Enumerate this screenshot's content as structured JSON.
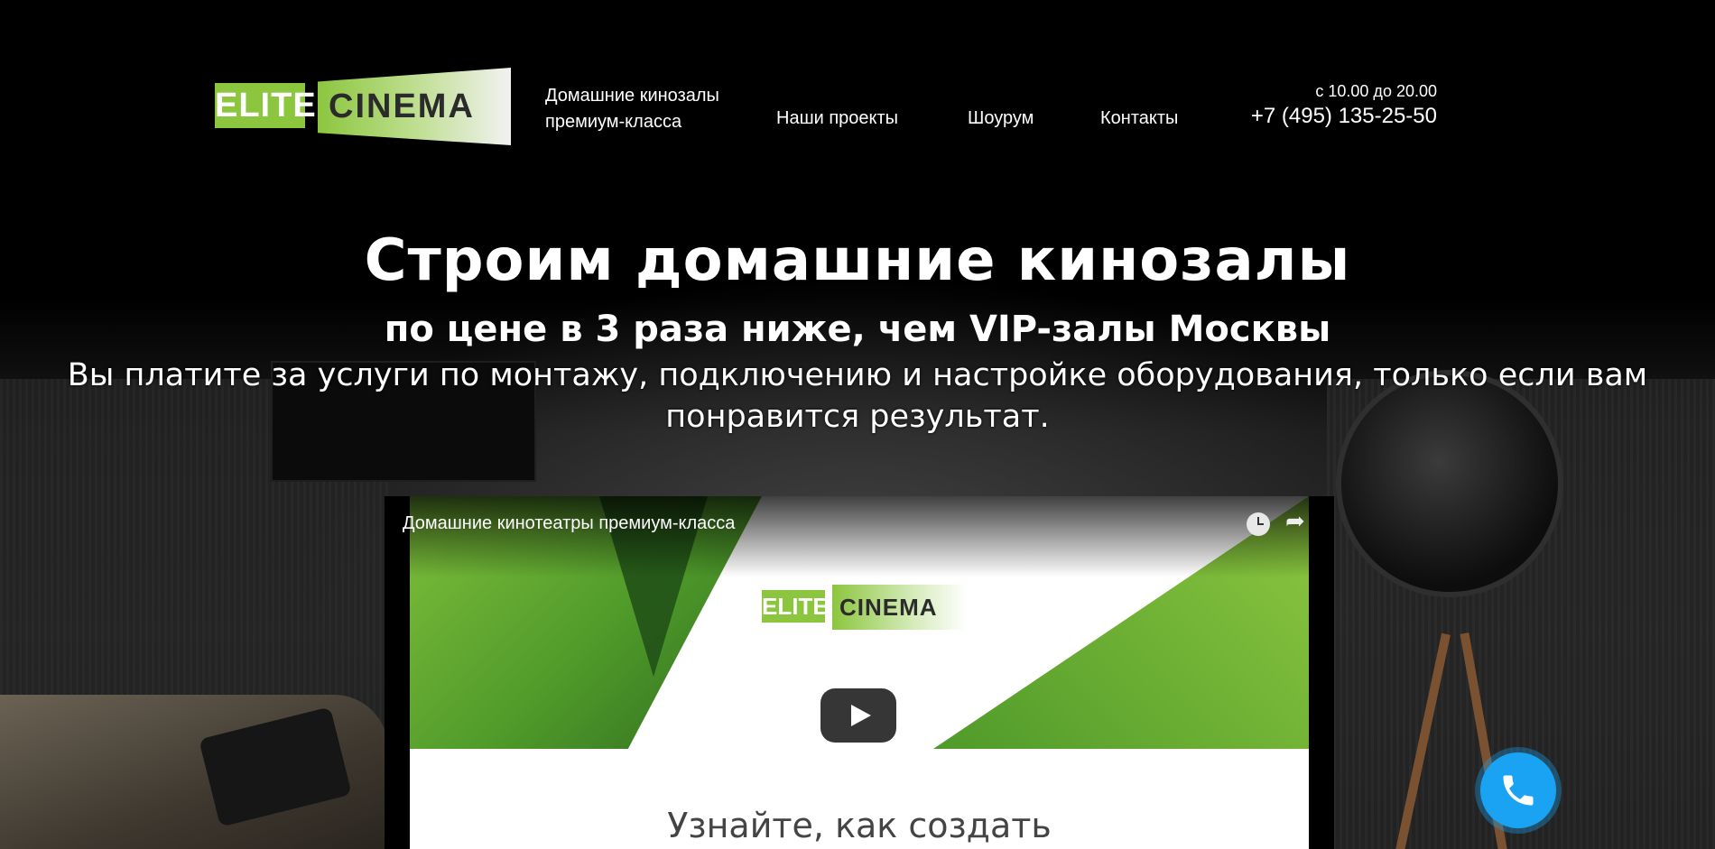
{
  "header": {
    "logo_left": "ELITE",
    "logo_right": "CINEMA",
    "tagline_line1": "Домашние кинозалы",
    "tagline_line2": "премиум-класса",
    "nav": [
      "Наши проекты",
      "Шоурум",
      "Контакты"
    ],
    "hours": "с 10.00 до 20.00",
    "phone": "+7 (495) 135-25-50"
  },
  "hero": {
    "title": "Строим домашние кинозалы",
    "subtitle": "по цене в 3 раза ниже, чем VIP-залы Москвы",
    "description": "Вы платите за услуги по монтажу, подключению и настройке оборудования, только если вам понравится результат."
  },
  "video": {
    "title": "Домашние кинотеатры премиум-класса",
    "logo_left": "ELITE",
    "logo_right": "CINEMA",
    "caption": "Узнайте, как создать",
    "icons": {
      "watch_later": "clock-icon",
      "share": "share-icon",
      "play": "play-icon"
    }
  },
  "call_button": {
    "icon": "phone-icon",
    "color": "#1aa3f2"
  },
  "colors": {
    "brand_green": "#8cc63f",
    "background": "#000000",
    "call_blue": "#1aa3f2"
  }
}
